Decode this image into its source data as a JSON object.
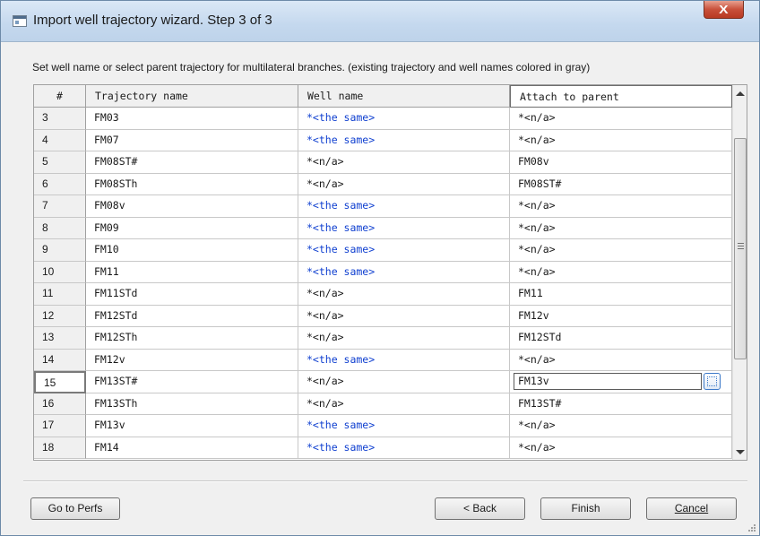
{
  "window": {
    "title": "Import well trajectory wizard. Step 3 of 3",
    "close_label": "X"
  },
  "instructions": "Set well name or select parent trajectory for multilateral branches. (existing trajectory and well names colored in gray)",
  "grid": {
    "columns": [
      "#",
      "Trajectory name",
      "Well name",
      "Attach to parent"
    ],
    "rows": [
      {
        "num": "3",
        "trajectory": "FM03",
        "well": "*<the same>",
        "parent": "*<n/a>"
      },
      {
        "num": "4",
        "trajectory": "FM07",
        "well": "*<the same>",
        "parent": "*<n/a>"
      },
      {
        "num": "5",
        "trajectory": "FM08ST#",
        "well": "*<n/a>",
        "parent": "FM08v"
      },
      {
        "num": "6",
        "trajectory": "FM08STh",
        "well": "*<n/a>",
        "parent": "FM08ST#"
      },
      {
        "num": "7",
        "trajectory": "FM08v",
        "well": "*<the same>",
        "parent": "*<n/a>"
      },
      {
        "num": "8",
        "trajectory": "FM09",
        "well": "*<the same>",
        "parent": "*<n/a>"
      },
      {
        "num": "9",
        "trajectory": "FM10",
        "well": "*<the same>",
        "parent": "*<n/a>"
      },
      {
        "num": "10",
        "trajectory": "FM11",
        "well": "*<the same>",
        "parent": "*<n/a>"
      },
      {
        "num": "11",
        "trajectory": "FM11STd",
        "well": "*<n/a>",
        "parent": "FM11"
      },
      {
        "num": "12",
        "trajectory": "FM12STd",
        "well": "*<n/a>",
        "parent": "FM12v"
      },
      {
        "num": "13",
        "trajectory": "FM12STh",
        "well": "*<n/a>",
        "parent": "FM12STd"
      },
      {
        "num": "14",
        "trajectory": "FM12v",
        "well": "*<the same>",
        "parent": "*<n/a>"
      },
      {
        "num": "15",
        "trajectory": "FM13ST#",
        "well": "*<n/a>",
        "parent": "FM13v"
      },
      {
        "num": "16",
        "trajectory": "FM13STh",
        "well": "*<n/a>",
        "parent": "FM13ST#"
      },
      {
        "num": "17",
        "trajectory": "FM13v",
        "well": "*<the same>",
        "parent": "*<n/a>"
      },
      {
        "num": "18",
        "trajectory": "FM14",
        "well": "*<the same>",
        "parent": "*<n/a>"
      }
    ],
    "current_row": "15"
  },
  "buttons": {
    "go_to_perfs": "Go to Perfs",
    "back": "< Back",
    "finish": "Finish",
    "cancel": "Cancel"
  },
  "colors": {
    "same_well_text": "#1040d0",
    "titlebar": "#c4d8ee",
    "close_button": "#c8503a"
  }
}
